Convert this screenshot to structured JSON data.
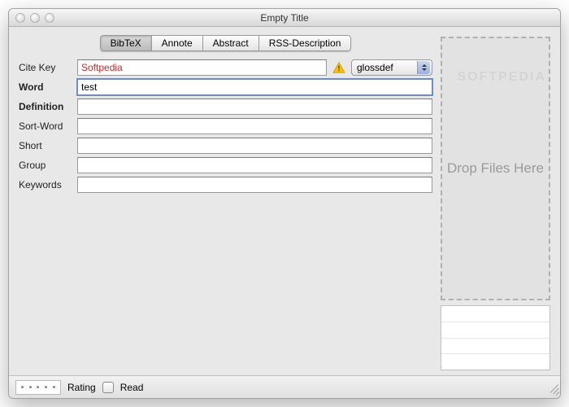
{
  "window": {
    "title": "Empty Title"
  },
  "tabs": {
    "items": [
      {
        "label": "BibTeX",
        "active": true
      },
      {
        "label": "Annote"
      },
      {
        "label": "Abstract"
      },
      {
        "label": "RSS-Description"
      }
    ]
  },
  "citeRow": {
    "label": "Cite Key",
    "value": "Softpedia",
    "selectValue": "glossdef"
  },
  "fields": [
    {
      "label": "Word",
      "bold": true,
      "value": "test"
    },
    {
      "label": "Definition",
      "bold": true,
      "value": ""
    },
    {
      "label": "Sort-Word",
      "bold": false,
      "value": ""
    },
    {
      "label": "Short",
      "bold": false,
      "value": ""
    },
    {
      "label": "Group",
      "bold": false,
      "value": ""
    },
    {
      "label": "Keywords",
      "bold": false,
      "value": ""
    }
  ],
  "dropzone": {
    "text": "Drop Files Here"
  },
  "bottom": {
    "ratingLabel": "Rating",
    "readLabel": "Read",
    "readChecked": false
  },
  "icons": {
    "warning": "warning-icon"
  },
  "watermark": "SOFTPEDIA"
}
